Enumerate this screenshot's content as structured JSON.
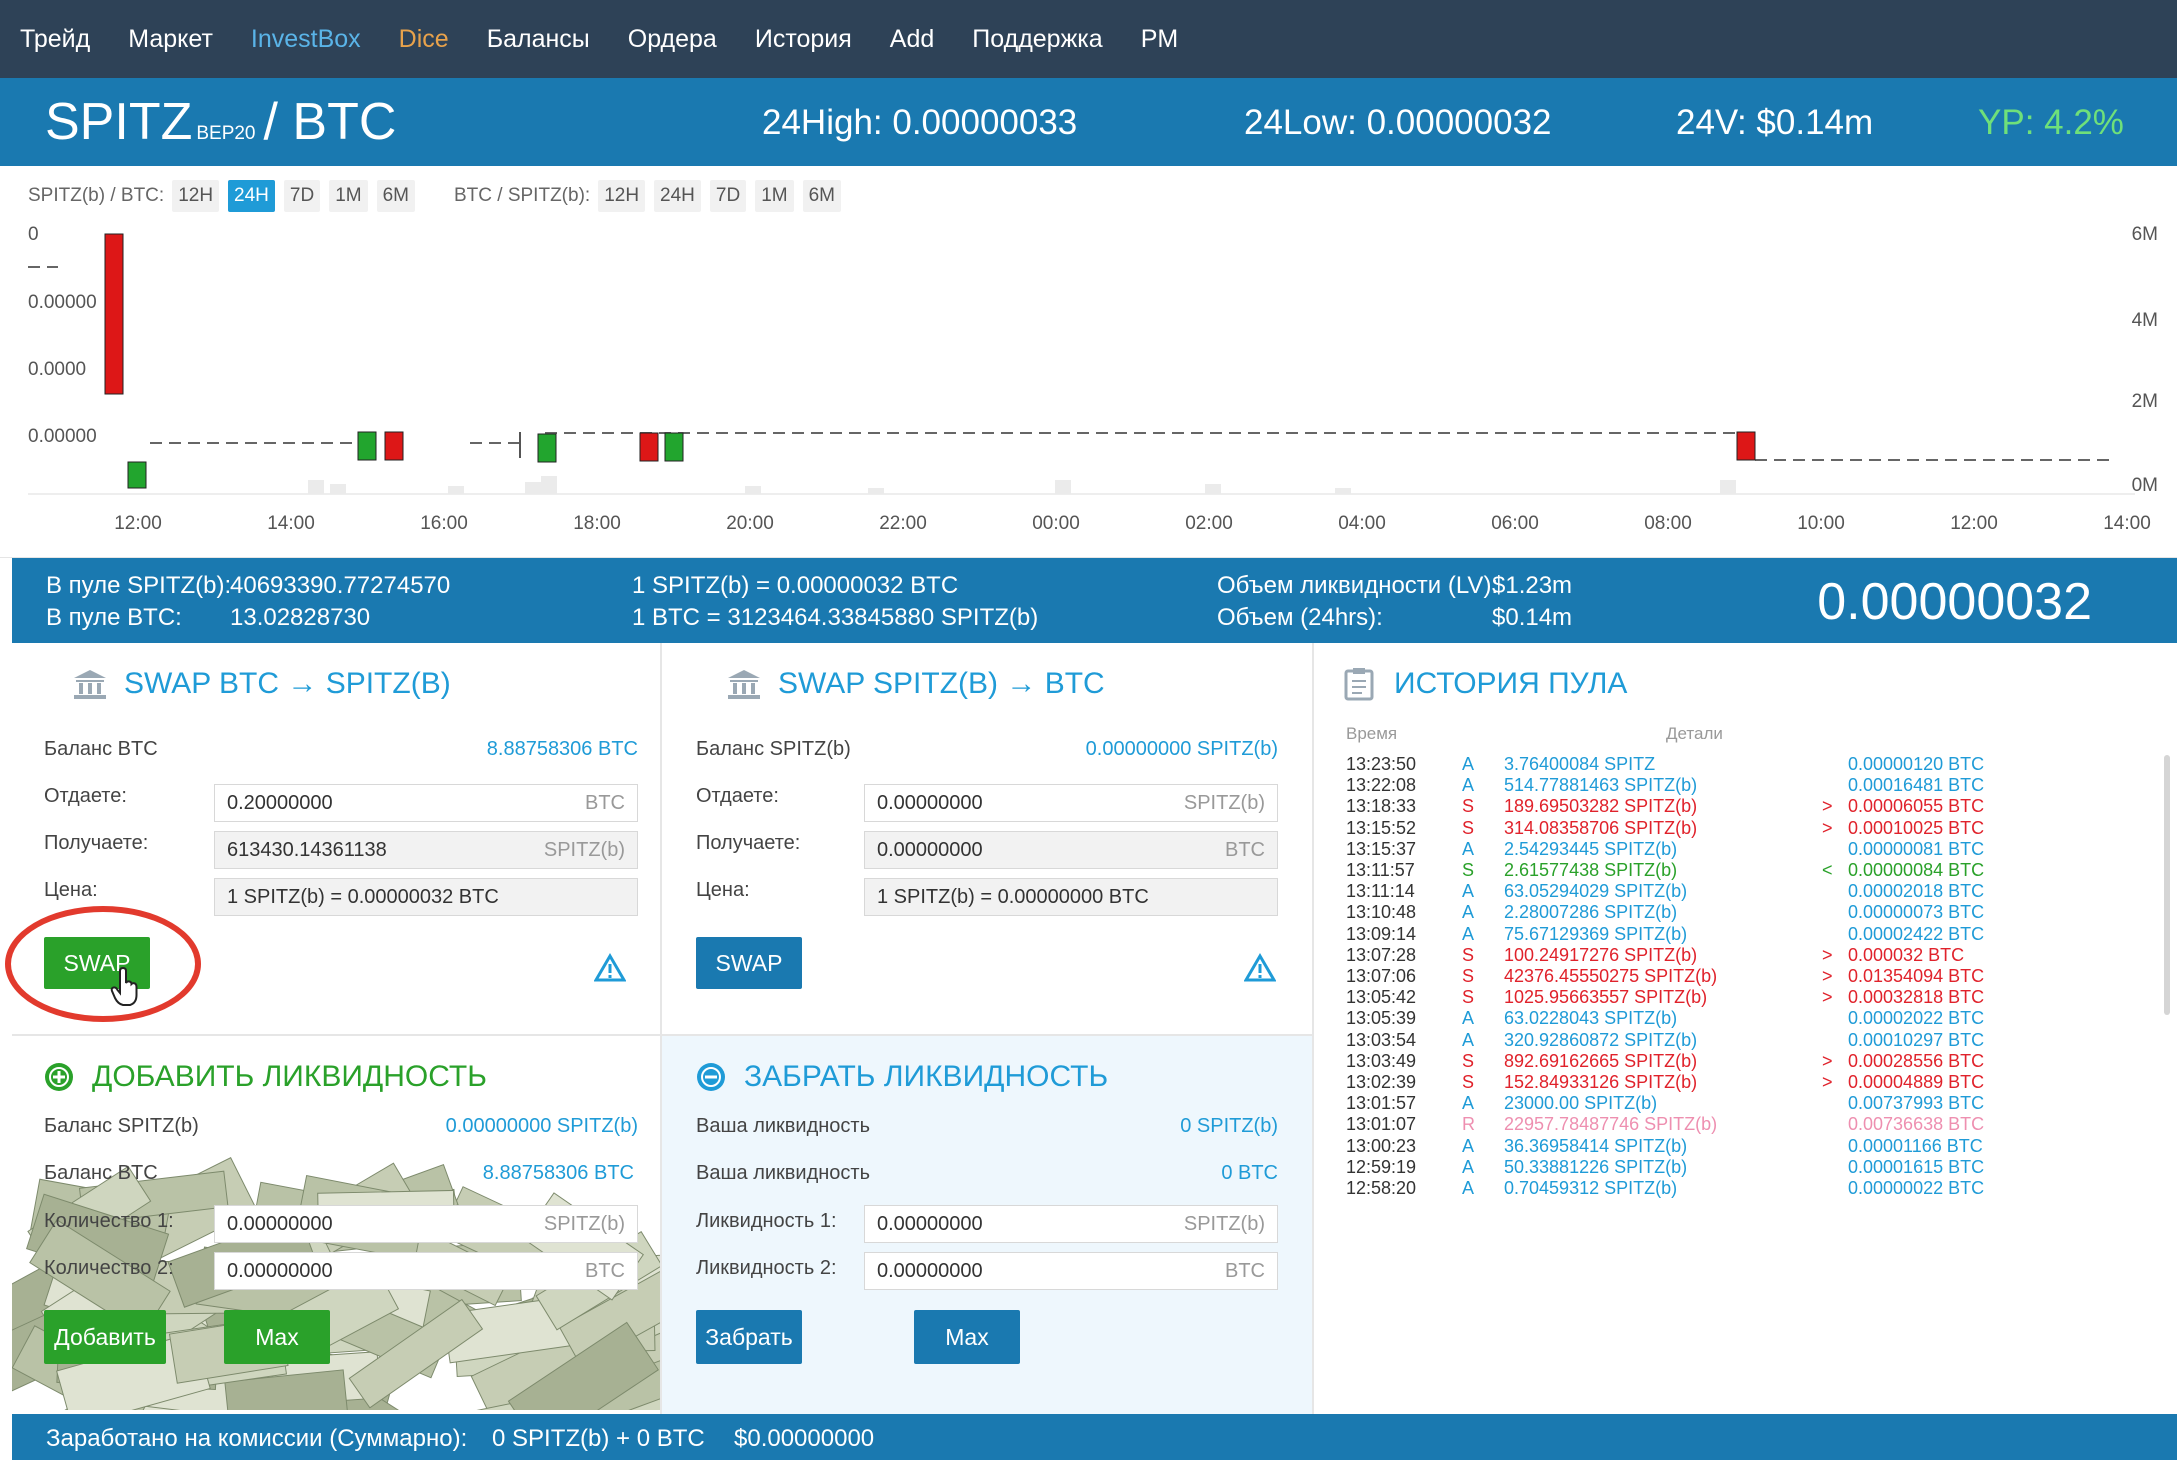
{
  "nav": {
    "items": [
      {
        "label": "Трейд",
        "color": "#ffffff"
      },
      {
        "label": "Маркет",
        "color": "#ffffff"
      },
      {
        "label": "InvestBox",
        "color": "#5ab4e8"
      },
      {
        "label": "Dice",
        "color": "#e8a24b"
      },
      {
        "label": "Балансы",
        "color": "#ffffff"
      },
      {
        "label": "Ордера",
        "color": "#ffffff"
      },
      {
        "label": "История",
        "color": "#ffffff"
      },
      {
        "label": "Add",
        "color": "#ffffff"
      },
      {
        "label": "Поддержка",
        "color": "#ffffff"
      },
      {
        "label": "PM",
        "color": "#ffffff"
      }
    ]
  },
  "pair": {
    "base": "SPITZ",
    "tag": "BEP20",
    "quote": "/ BTC",
    "high": "24High: 0.00000033",
    "low": "24Low: 0.00000032",
    "volume": "24V: $0.14m",
    "yp": "YP: 4.2%"
  },
  "chart": {
    "tf1": {
      "label": "SPITZ(b) / BTC:",
      "buttons": [
        "12H",
        "24H",
        "7D",
        "1M",
        "6M"
      ],
      "active": "24H"
    },
    "tf2": {
      "label": "BTC / SPITZ(b):",
      "buttons": [
        "12H",
        "24H",
        "7D",
        "1M",
        "6M"
      ],
      "active": ""
    }
  },
  "chart_data": {
    "type": "candlestick",
    "title": "",
    "xlabel": "",
    "ylabel": "",
    "y_ticks_left": [
      "0",
      "0.00000",
      "0.0000",
      "0.00000"
    ],
    "y_ticks_right": [
      "6M",
      "4M",
      "2M",
      "0M"
    ],
    "x_ticks": [
      "12:00",
      "14:00",
      "16:00",
      "18:00",
      "20:00",
      "22:00",
      "00:00",
      "02:00",
      "04:00",
      "06:00",
      "08:00",
      "10:00",
      "12:00",
      "14:00"
    ],
    "colors": {
      "up": "#22a52e",
      "down": "#dd1717"
    }
  },
  "pool": {
    "pool_spitz_label": "В пуле SPITZ(b):",
    "pool_spitz_value": "40693390.77274570",
    "pool_btc_label": "В пуле BTC:",
    "pool_btc_value": "13.02828730",
    "rate1": "1 SPITZ(b) = 0.00000032 BTC",
    "rate2": "1 BTC = 3123464.33845880 SPITZ(b)",
    "lv_label": "Объем ликвидности (LV):",
    "lv_value": "$1.23m",
    "vol_label": "Объем (24hrs):",
    "vol_value": "$0.14m",
    "price": "0.00000032"
  },
  "swap1": {
    "title": "SWAP BTC → SPITZ(B)",
    "balance_label": "Баланс BTC",
    "balance_value": "8.88758306 BTC",
    "give_label": "Отдаете:",
    "give_value": "0.20000000",
    "give_unit": "BTC",
    "get_label": "Получаете:",
    "get_value": "613430.14361138",
    "get_unit": "SPITZ(b)",
    "price_label": "Цена:",
    "price_value": "1 SPITZ(b) = 0.00000032 BTC",
    "button": "SWAP"
  },
  "swap2": {
    "title": "SWAP SPITZ(B) → BTC",
    "balance_label": "Баланс SPITZ(b)",
    "balance_value": "0.00000000 SPITZ(b)",
    "give_label": "Отдаете:",
    "give_value": "0.00000000",
    "give_unit": "SPITZ(b)",
    "get_label": "Получаете:",
    "get_value": "0.00000000",
    "get_unit": "BTC",
    "price_label": "Цена:",
    "price_value": "1 SPITZ(b) = 0.00000000 BTC",
    "button": "SWAP"
  },
  "add_liq": {
    "title": "ДОБАВИТЬ ЛИКВИДНОСТЬ",
    "bal_spitz_label": "Баланс SPITZ(b)",
    "bal_spitz_value": "0.00000000 SPITZ(b)",
    "bal_btc_label": "Баланс BTC",
    "bal_btc_value": "8.88758306 BTC",
    "qty1_label": "Количество 1:",
    "qty1_value": "0.00000000",
    "qty1_unit": "SPITZ(b)",
    "qty2_label": "Количество 2:",
    "qty2_value": "0.00000000",
    "qty2_unit": "BTC",
    "add_button": "Добавить",
    "max_button": "Max"
  },
  "remove_liq": {
    "title": "ЗАБРАТЬ ЛИКВИДНОСТЬ",
    "your1_label": "Ваша ликвидность",
    "your1_value": "0 SPITZ(b)",
    "your2_label": "Ваша ликвидность",
    "your2_value": "0 BTC",
    "liq1_label": "Ликвидность 1:",
    "liq1_value": "0.00000000",
    "liq1_unit": "SPITZ(b)",
    "liq2_label": "Ликвидность 2:",
    "liq2_value": "0.00000000",
    "liq2_unit": "BTC",
    "take_button": "Забрать",
    "max_button": "Max"
  },
  "history": {
    "title": "ИСТОРИЯ ПУЛА",
    "col_time": "Время",
    "col_details": "Детали",
    "rows": [
      {
        "time": "13:23:50",
        "type": "A",
        "amount": "3.76400084 SPITZ",
        "arrow": "",
        "btc": "0.00000120 BTC",
        "color": "#1f9bd7"
      },
      {
        "time": "13:22:08",
        "type": "A",
        "amount": "514.77881463 SPITZ(b)",
        "arrow": "",
        "btc": "0.00016481 BTC",
        "color": "#1f9bd7"
      },
      {
        "time": "13:18:33",
        "type": "S",
        "amount": "189.69503282 SPITZ(b)",
        "arrow": ">",
        "btc": "0.00006055 BTC",
        "color": "#e0222b"
      },
      {
        "time": "13:15:52",
        "type": "S",
        "amount": "314.08358706 SPITZ(b)",
        "arrow": ">",
        "btc": "0.00010025 BTC",
        "color": "#e0222b"
      },
      {
        "time": "13:15:37",
        "type": "A",
        "amount": "2.54293445 SPITZ(b)",
        "arrow": "",
        "btc": "0.00000081 BTC",
        "color": "#1f9bd7"
      },
      {
        "time": "13:11:57",
        "type": "S",
        "amount": "2.61577438 SPITZ(b)",
        "arrow": "<",
        "btc": "0.00000084 BTC",
        "color": "#2aa12a"
      },
      {
        "time": "13:11:14",
        "type": "A",
        "amount": "63.05294029 SPITZ(b)",
        "arrow": "",
        "btc": "0.00002018 BTC",
        "color": "#1f9bd7"
      },
      {
        "time": "13:10:48",
        "type": "A",
        "amount": "2.28007286 SPITZ(b)",
        "arrow": "",
        "btc": "0.00000073 BTC",
        "color": "#1f9bd7"
      },
      {
        "time": "13:09:14",
        "type": "A",
        "amount": "75.67129369 SPITZ(b)",
        "arrow": "",
        "btc": "0.00002422 BTC",
        "color": "#1f9bd7"
      },
      {
        "time": "13:07:28",
        "type": "S",
        "amount": "100.24917276 SPITZ(b)",
        "arrow": ">",
        "btc": "0.000032 BTC",
        "color": "#e0222b"
      },
      {
        "time": "13:07:06",
        "type": "S",
        "amount": "42376.45550275 SPITZ(b)",
        "arrow": ">",
        "btc": "0.01354094 BTC",
        "color": "#e0222b"
      },
      {
        "time": "13:05:42",
        "type": "S",
        "amount": "1025.95663557 SPITZ(b)",
        "arrow": ">",
        "btc": "0.00032818 BTC",
        "color": "#e0222b"
      },
      {
        "time": "13:05:39",
        "type": "A",
        "amount": "63.0228043 SPITZ(b)",
        "arrow": "",
        "btc": "0.00002022 BTC",
        "color": "#1f9bd7"
      },
      {
        "time": "13:03:54",
        "type": "A",
        "amount": "320.92860872 SPITZ(b)",
        "arrow": "",
        "btc": "0.00010297 BTC",
        "color": "#1f9bd7"
      },
      {
        "time": "13:03:49",
        "type": "S",
        "amount": "892.69162665 SPITZ(b)",
        "arrow": ">",
        "btc": "0.00028556 BTC",
        "color": "#e0222b"
      },
      {
        "time": "13:02:39",
        "type": "S",
        "amount": "152.84933126 SPITZ(b)",
        "arrow": ">",
        "btc": "0.00004889 BTC",
        "color": "#e0222b"
      },
      {
        "time": "13:01:57",
        "type": "A",
        "amount": "23000.00 SPITZ(b)",
        "arrow": "",
        "btc": "0.00737993 BTC",
        "color": "#1f9bd7"
      },
      {
        "time": "13:01:07",
        "type": "R",
        "amount": "22957.78487746 SPITZ(b)",
        "arrow": "",
        "btc": "0.00736638 BTC",
        "color": "#ee8fb0"
      },
      {
        "time": "13:00:23",
        "type": "A",
        "amount": "36.36958414 SPITZ(b)",
        "arrow": "",
        "btc": "0.00001166 BTC",
        "color": "#1f9bd7"
      },
      {
        "time": "12:59:19",
        "type": "A",
        "amount": "50.33881226 SPITZ(b)",
        "arrow": "",
        "btc": "0.00001615 BTC",
        "color": "#1f9bd7"
      },
      {
        "time": "12:58:20",
        "type": "A",
        "amount": "0.70459312 SPITZ(b)",
        "arrow": "",
        "btc": "0.00000022 BTC",
        "color": "#1f9bd7"
      }
    ]
  },
  "footer": {
    "label": "Заработано на комиссии (Суммарно):",
    "value": "0 SPITZ(b) + 0 BTC",
    "usd": "$0.00000000"
  }
}
